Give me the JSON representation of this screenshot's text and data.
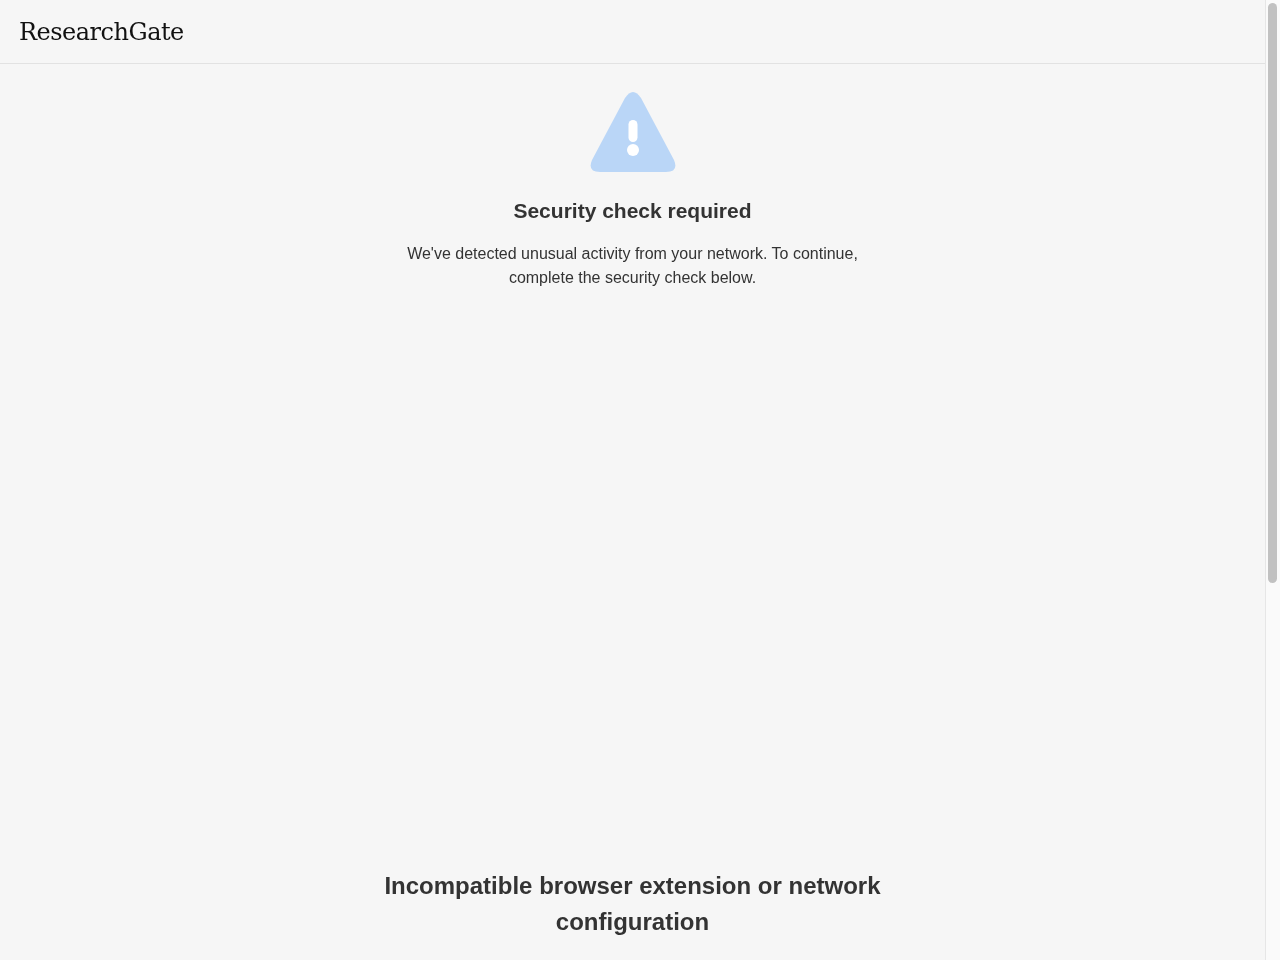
{
  "header": {
    "logo": "ResearchGate"
  },
  "security_check": {
    "title": "Security check required",
    "message": "We've detected unusual activity from your network. To continue, complete the security check below."
  },
  "incompatible_notice": {
    "title": "Incompatible browser extension or network configuration"
  }
}
